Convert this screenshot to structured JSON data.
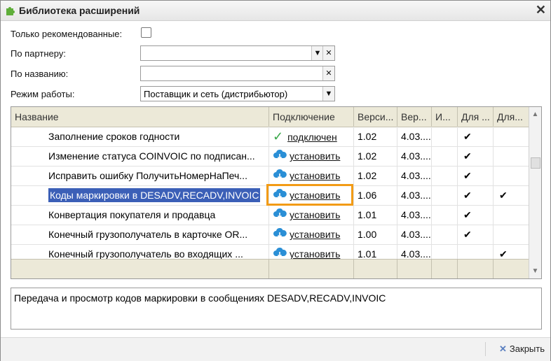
{
  "window": {
    "title": "Библиотека расширений"
  },
  "filters": {
    "recommended_label": "Только рекомендованные:",
    "partner_label": "По партнеру:",
    "partner_value": "",
    "name_label": "По названию:",
    "name_value": "",
    "mode_label": "Режим работы:",
    "mode_value": "Поставщик и сеть (дистрибьютор)"
  },
  "grid": {
    "columns": [
      "Название",
      "Подключение",
      "Верси...",
      "Вер...",
      "И...",
      "Для ...",
      "Для..."
    ],
    "rows": [
      {
        "name": "Заполнение сроков годности",
        "status": "подключен",
        "status_type": "connected",
        "version": "1.02",
        "ver2": "4.03....",
        "i": "",
        "for1": "✔",
        "for2": ""
      },
      {
        "name": "Изменение статуса COINVOIC по подписан...",
        "status": "установить",
        "status_type": "install",
        "version": "1.02",
        "ver2": "4.03....",
        "i": "",
        "for1": "✔",
        "for2": ""
      },
      {
        "name": "Исправить ошибку ПолучитьНомерНаПеч...",
        "status": "установить",
        "status_type": "install",
        "version": "1.02",
        "ver2": "4.03....",
        "i": "",
        "for1": "✔",
        "for2": ""
      },
      {
        "name": "Коды маркировки в DESADV,RECADV,INVOIC",
        "status": "установить",
        "status_type": "install",
        "version": "1.06",
        "ver2": "4.03....",
        "i": "",
        "for1": "✔",
        "for2": "✔",
        "selected": true
      },
      {
        "name": "Конвертация покупателя и продавца",
        "status": "установить",
        "status_type": "install",
        "version": "1.01",
        "ver2": "4.03....",
        "i": "",
        "for1": "✔",
        "for2": ""
      },
      {
        "name": "Конечный грузополучатель в карточке OR...",
        "status": "установить",
        "status_type": "install",
        "version": "1.00",
        "ver2": "4.03....",
        "i": "",
        "for1": "✔",
        "for2": ""
      },
      {
        "name": "Конечный грузополучатель во входящих ...",
        "status": "установить",
        "status_type": "install",
        "version": "1.01",
        "ver2": "4.03....",
        "i": "",
        "for1": "",
        "for2": "✔"
      }
    ]
  },
  "description": "Передача и просмотр кодов маркировки в сообщениях DESADV,RECADV,INVOIC",
  "footer": {
    "close_label": "Закрыть"
  },
  "colors": {
    "selection": "#3b5fb7",
    "highlight": "#f29b16",
    "header_bg": "#ece9d8",
    "cloud": "#2a8fd6",
    "tick": "#3aa84a"
  }
}
